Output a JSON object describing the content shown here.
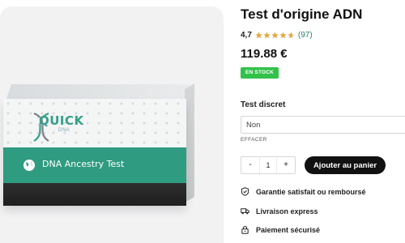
{
  "product": {
    "title": "Test d'origine ADN",
    "rating_value": "4,7",
    "rating_count": "(97)",
    "rating_stars": 4.7,
    "price": "119.88 €",
    "stock_badge": "EN STOCK",
    "image": {
      "brand_text": "QUICK",
      "brand_sub": "DNA",
      "band_text": "DNA Ancestry Test"
    },
    "option": {
      "label": "Test discret",
      "selected": "Non",
      "clear_label": "EFFACER"
    },
    "quantity": {
      "minus": "-",
      "value": "1",
      "plus": "+"
    },
    "add_to_cart_label": "Ajouter au panier",
    "features": [
      {
        "icon": "shield-check-icon",
        "label": "Garantie satisfait ou remboursé"
      },
      {
        "icon": "truck-icon",
        "label": "Livraison express"
      },
      {
        "icon": "lock-icon",
        "label": "Paiement sécurisé"
      }
    ]
  },
  "colors": {
    "accent_green": "#2f9b80",
    "stock_green": "#32c24a",
    "star": "#e7a53a",
    "button_dark": "#111111"
  }
}
